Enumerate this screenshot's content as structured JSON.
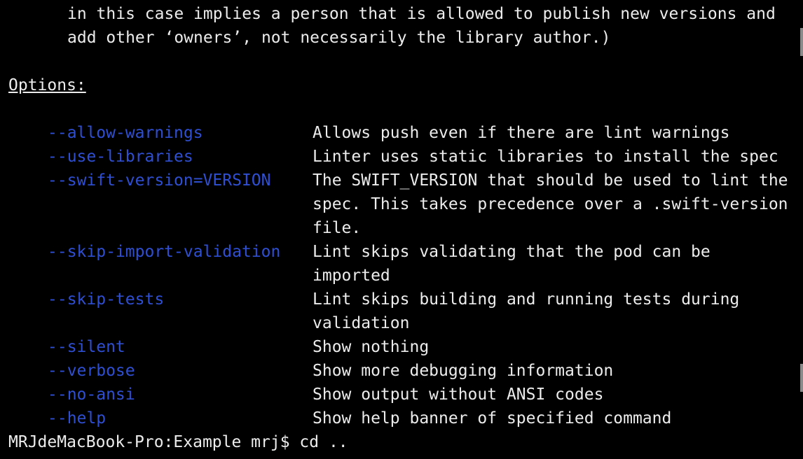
{
  "intro": {
    "line1": "in this case implies a person that is allowed to publish new versions and",
    "line2": "add other ‘owners’, not necessarily the library author.)"
  },
  "options_heading": "Options:",
  "options": [
    {
      "name": "--allow-warnings",
      "desc": [
        "Allows push even if there are lint warnings"
      ]
    },
    {
      "name": "--use-libraries",
      "desc": [
        "Linter uses static libraries to install the spec"
      ]
    },
    {
      "name": "--swift-version=VERSION",
      "desc": [
        "The SWIFT_VERSION that should be used to lint the",
        "spec. This takes precedence over a .swift-version",
        "file."
      ]
    },
    {
      "name": "--skip-import-validation",
      "desc": [
        "Lint skips validating that the pod can be",
        "imported"
      ]
    },
    {
      "name": "--skip-tests",
      "desc": [
        "Lint skips building and running tests during",
        "validation"
      ]
    },
    {
      "name": "--silent",
      "desc": [
        "Show nothing"
      ]
    },
    {
      "name": "--verbose",
      "desc": [
        "Show more debugging information"
      ]
    },
    {
      "name": "--no-ansi",
      "desc": [
        "Show output without ANSI codes"
      ]
    },
    {
      "name": "--help",
      "desc": [
        "Show help banner of specified command"
      ]
    }
  ],
  "prompt": {
    "text": "MRJdeMacBook-Pro:Example mrj$ cd .."
  },
  "colors": {
    "background": "#000000",
    "text": "#ececec",
    "option": "#2f4fd2"
  }
}
